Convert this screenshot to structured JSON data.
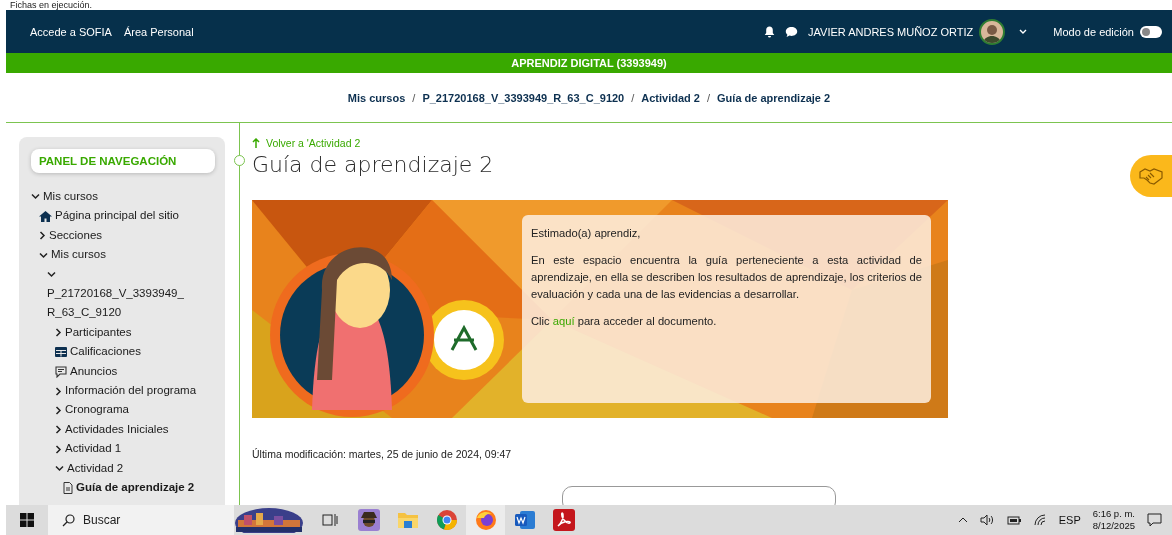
{
  "page_caption": "Fichas en ejecución.",
  "navbar": {
    "links": [
      "Accede a SOFIA",
      "Área Personal"
    ],
    "user_name": "JAVIER ANDRES MUÑOZ ORTIZ",
    "edit_mode": {
      "label": "Modo de edición",
      "on": false
    }
  },
  "course_banner": "APRENDIZ DIGITAL (3393949)",
  "breadcrumb": [
    {
      "kind": "link",
      "text": "Mis cursos"
    },
    {
      "kind": "separator",
      "text": "/"
    },
    {
      "kind": "link",
      "text": "P_21720168_V_3393949_R_63_C_9120"
    },
    {
      "kind": "separator",
      "text": "/"
    },
    {
      "kind": "link",
      "text": "Actividad 2"
    },
    {
      "kind": "separator",
      "text": "/"
    },
    {
      "kind": "link",
      "text": "Guía de aprendizaje 2"
    }
  ],
  "sidebar": {
    "title": "PANEL DE NAVEGACIÓN",
    "tree": [
      {
        "kind": "branch",
        "label": "Mis cursos",
        "expanded": true,
        "selected": false,
        "children": [
          {
            "kind": "home",
            "label": "Página principal del sitio",
            "selected": false
          },
          {
            "kind": "branch",
            "label": "Secciones",
            "expanded": false,
            "selected": false
          },
          {
            "kind": "branch",
            "label": "Mis cursos",
            "expanded": true,
            "selected": false,
            "children": [
              {
                "kind": "branch",
                "label": "P_21720168_V_3393949_R_63_C_9120",
                "expanded": true,
                "selected": false,
                "children": [
                  {
                    "kind": "branch",
                    "label": "Participantes",
                    "expanded": false,
                    "selected": false
                  },
                  {
                    "kind": "grades",
                    "label": "Calificaciones",
                    "selected": false
                  },
                  {
                    "kind": "forum",
                    "label": "Anuncios",
                    "selected": false
                  },
                  {
                    "kind": "branch",
                    "label": "Información del programa",
                    "expanded": false,
                    "selected": false
                  },
                  {
                    "kind": "branch",
                    "label": "Cronograma",
                    "expanded": false,
                    "selected": false
                  },
                  {
                    "kind": "branch",
                    "label": "Actividades Iniciales",
                    "expanded": false,
                    "selected": false
                  },
                  {
                    "kind": "branch",
                    "label": "Actividad 1",
                    "expanded": false,
                    "selected": false
                  },
                  {
                    "kind": "branch",
                    "label": "Actividad 2",
                    "expanded": true,
                    "selected": false,
                    "children": [
                      {
                        "kind": "page",
                        "label": "Guía de aprendizaje 2",
                        "selected": true
                      }
                    ]
                  }
                ]
              }
            ]
          }
        ]
      }
    ]
  },
  "content": {
    "back_link": "Volver a 'Actividad 2",
    "title": "Guía de aprendizaje 2",
    "notice": {
      "greeting": "Estimado(a) aprendiz,",
      "body": "En este espacio encuentra la guía perteneciente a esta actividad de aprendizaje, en ella se describen los resultados de aprendizaje, los criterios de evaluación y cada una de las evidencias a desarrollar.",
      "cta_before": "Clic",
      "cta_link": "aquí",
      "cta_after": "para acceder al documento."
    },
    "last_modified": "Última modificación: martes, 25 de junio de 2024, 09:47"
  },
  "taskbar": {
    "search_placeholder": "Buscar",
    "apps": [
      {
        "kind": "taskview",
        "active": false
      },
      {
        "kind": "spy",
        "active": false
      },
      {
        "kind": "folder",
        "active": false
      },
      {
        "kind": "chrome",
        "active": false
      },
      {
        "kind": "firefox",
        "active": true
      },
      {
        "kind": "word",
        "active": false
      },
      {
        "kind": "pdf",
        "active": false
      }
    ],
    "language": "ESP",
    "time": "6:16 p. m.",
    "date": "8/12/2025"
  }
}
